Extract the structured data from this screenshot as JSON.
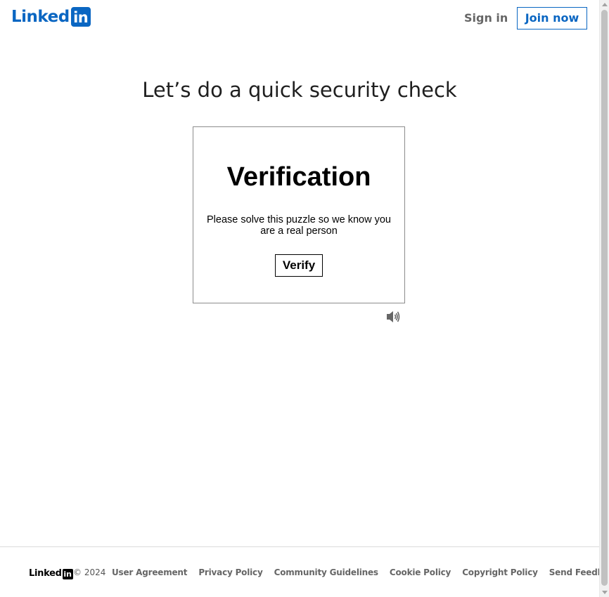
{
  "header": {
    "logo_text": "Linked",
    "logo_badge": "in",
    "signin_label": "Sign in",
    "join_label": "Join now"
  },
  "main": {
    "title": "Let’s do a quick security check",
    "card": {
      "heading": "Verification",
      "message": "Please solve this puzzle so we know you are a real person",
      "verify_label": "Verify"
    },
    "audio_icon": "speaker-icon"
  },
  "footer": {
    "logo_text": "Linked",
    "logo_badge": "in",
    "copyright": "© 2024",
    "links": [
      "User Agreement",
      "Privacy Policy",
      "Community Guidelines",
      "Cookie Policy",
      "Copyright Policy",
      "Send Feedback"
    ]
  },
  "colors": {
    "brand": "#0a66c2",
    "link_gray": "#666666",
    "card_border": "#8c8c8c"
  }
}
